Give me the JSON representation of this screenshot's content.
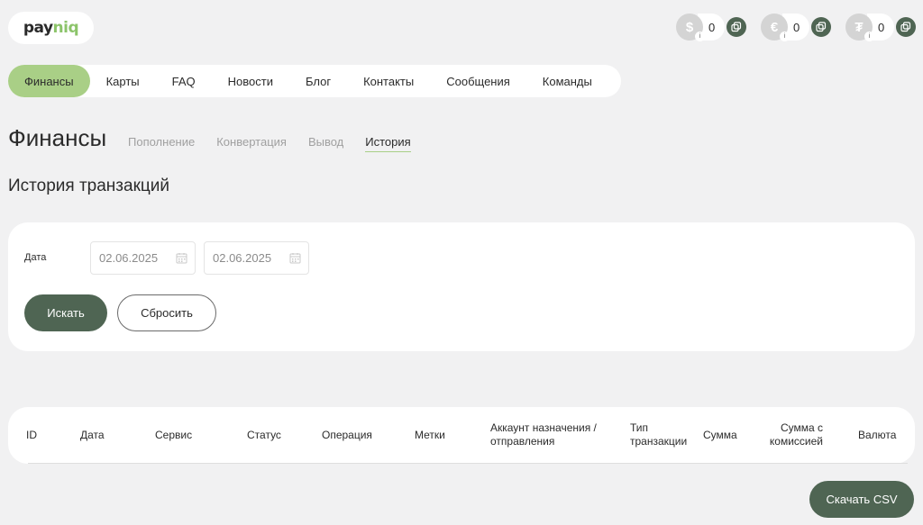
{
  "logo": {
    "pay": "pay",
    "niq": "niq"
  },
  "balances": [
    {
      "symbol": "$",
      "amount": "0",
      "icon": "dollar-coin-icon"
    },
    {
      "symbol": "€",
      "amount": "0",
      "icon": "euro-coin-icon"
    },
    {
      "symbol": "₮",
      "amount": "0",
      "icon": "tether-coin-icon"
    }
  ],
  "nav": {
    "items": [
      "Финансы",
      "Карты",
      "FAQ",
      "Новости",
      "Блог",
      "Контакты",
      "Сообщения",
      "Команды"
    ],
    "active": "Финансы"
  },
  "page": {
    "title": "Финансы",
    "subtabs": [
      "Пополнение",
      "Конвертация",
      "Вывод",
      "История"
    ],
    "active_subtab": "История",
    "section_title": "История транзакций"
  },
  "filter": {
    "date_label": "Дата",
    "date_from": "02.06.2025",
    "date_to": "02.06.2025",
    "search_label": "Искать",
    "reset_label": "Сбросить"
  },
  "table": {
    "columns": [
      "ID",
      "Дата",
      "Сервис",
      "Статус",
      "Операция",
      "Метки",
      "Аккаунт назначения /отправления",
      "Тип транзакции",
      "Сумма",
      "Сумма с комиссией",
      "Валюта"
    ]
  },
  "download_label": "Скачать CSV",
  "colors": {
    "accent_green": "#a9cf86",
    "dark_green": "#4f6553",
    "background": "#f1f1f2"
  }
}
